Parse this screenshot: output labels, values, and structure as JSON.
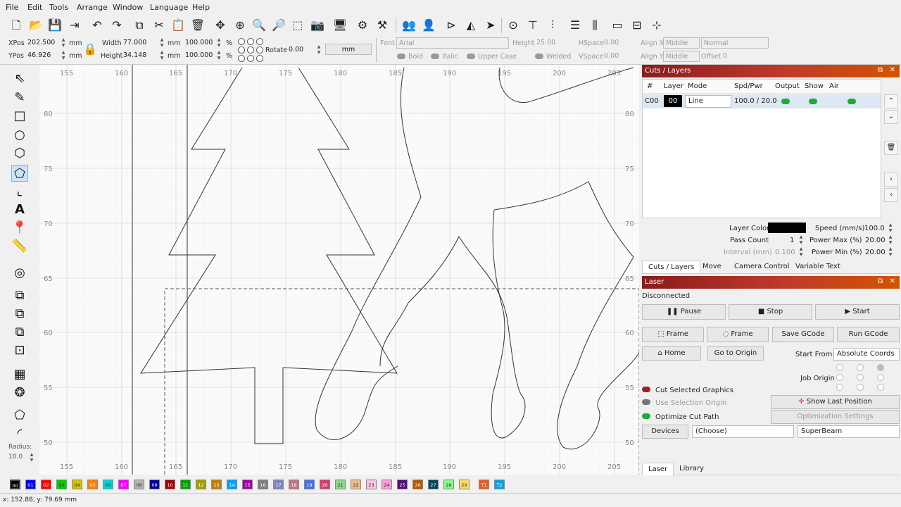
{
  "menu": [
    "File",
    "Edit",
    "Tools",
    "Arrange",
    "Window",
    "Language",
    "Help"
  ],
  "props": {
    "xpos_label": "XPos",
    "xpos": "202.500",
    "ypos_label": "YPos",
    "ypos": "46.926",
    "unit": "mm",
    "width_label": "Width",
    "width": "77.000",
    "height_label": "Height",
    "height": "34.148",
    "scale_w": "100.000",
    "scale_h": "100.000",
    "pct": "%",
    "rotate_label": "Rotate",
    "rotate": "0.00",
    "mm_button": "mm",
    "font_label": "Font",
    "font": "Arial",
    "fheight_label": "Height",
    "fheight": "25.00",
    "hspace_label": "HSpace",
    "hspace": "0.00",
    "vspace_label": "VSpace",
    "vspace": "0.00",
    "alignx_label": "Align X",
    "alignx": "Middle",
    "aligny_label": "Align Y",
    "aligny": "Middle",
    "style": "Normal",
    "offset_label": "Offset",
    "offset": "0",
    "bold": "Bold",
    "italic": "Italic",
    "upper": "Upper Case",
    "welded": "Welded"
  },
  "radius": {
    "label": "Radius:",
    "value": "10.0"
  },
  "ruler": {
    "top": [
      "155",
      "160",
      "165",
      "170",
      "175",
      "180",
      "185",
      "190",
      "195",
      "200",
      "205"
    ],
    "left": [
      "80",
      "75",
      "70",
      "65",
      "60",
      "55",
      "50"
    ]
  },
  "cuts": {
    "title": "Cuts / Layers",
    "headers": [
      "#",
      "Layer",
      "Mode",
      "Spd/Pwr",
      "Output",
      "Show",
      "Air"
    ],
    "row": {
      "num": "C00",
      "layer": "00",
      "mode": "Line",
      "spdpwr": "100.0 / 20.0"
    },
    "layer_color_label": "Layer Color",
    "layer_color": "#000000",
    "speed_label": "Speed (mm/s)",
    "speed": "100.0",
    "pass_label": "Pass Count",
    "pass": "1",
    "pmax_label": "Power Max (%)",
    "pmax": "20.00",
    "interval_label": "Interval (mm)",
    "interval": "0.100",
    "pmin_label": "Power Min (%)",
    "pmin": "20.00",
    "tabs": [
      "Cuts / Layers",
      "Move",
      "Camera Control",
      "Variable Text"
    ]
  },
  "laser": {
    "title": "Laser",
    "status": "Disconnected",
    "pause": "Pause",
    "stop": "Stop",
    "start": "Start",
    "frame1": "Frame",
    "frame2": "Frame",
    "save": "Save GCode",
    "run": "Run GCode",
    "home": "Home",
    "origin": "Go to Origin",
    "start_from_label": "Start From:",
    "start_from": "Absolute Coords",
    "job_origin": "Job Origin",
    "cut_selected": "Cut Selected Graphics",
    "use_sel": "Use Selection Origin",
    "optimize": "Optimize Cut Path",
    "show_last": "Show Last Position",
    "opt_settings": "Optimization Settings",
    "devices": "Devices",
    "choose": "(Choose)",
    "device": "SuperBeam",
    "tabs": [
      "Laser",
      "Library"
    ]
  },
  "palette": [
    {
      "label": "00",
      "color": "#000000"
    },
    {
      "label": "01",
      "color": "#0000ff"
    },
    {
      "label": "02",
      "color": "#ff0000"
    },
    {
      "label": "03",
      "color": "#00cc00"
    },
    {
      "label": "04",
      "color": "#d4c200"
    },
    {
      "label": "05",
      "color": "#ff8000"
    },
    {
      "label": "06",
      "color": "#00d4d4"
    },
    {
      "label": "07",
      "color": "#ff00ff"
    },
    {
      "label": "08",
      "color": "#b4b4b4"
    },
    {
      "label": "09",
      "color": "#0000a0"
    },
    {
      "label": "10",
      "color": "#a00000"
    },
    {
      "label": "11",
      "color": "#00a000"
    },
    {
      "label": "12",
      "color": "#a0a000"
    },
    {
      "label": "13",
      "color": "#c08000"
    },
    {
      "label": "14",
      "color": "#00a0ff"
    },
    {
      "label": "15",
      "color": "#a000a0"
    },
    {
      "label": "16",
      "color": "#808080"
    },
    {
      "label": "17",
      "color": "#7d87b9"
    },
    {
      "label": "18",
      "color": "#bb7784"
    },
    {
      "label": "19",
      "color": "#4a6fe3"
    },
    {
      "label": "20",
      "color": "#d33f6a"
    },
    {
      "label": "21",
      "color": "#8cd78c"
    },
    {
      "label": "22",
      "color": "#f0b98d"
    },
    {
      "label": "23",
      "color": "#f6c4e1"
    },
    {
      "label": "24",
      "color": "#fa9ed4"
    },
    {
      "label": "25",
      "color": "#500a78"
    },
    {
      "label": "26",
      "color": "#b45a00"
    },
    {
      "label": "27",
      "color": "#004754"
    },
    {
      "label": "28",
      "color": "#86fa88"
    },
    {
      "label": "29",
      "color": "#ffdb66"
    },
    {
      "label": "T1",
      "color": "#f05a28"
    },
    {
      "label": "T2",
      "color": "#14a0dc"
    }
  ],
  "status": "x: 152.88, y: 79.69 mm"
}
